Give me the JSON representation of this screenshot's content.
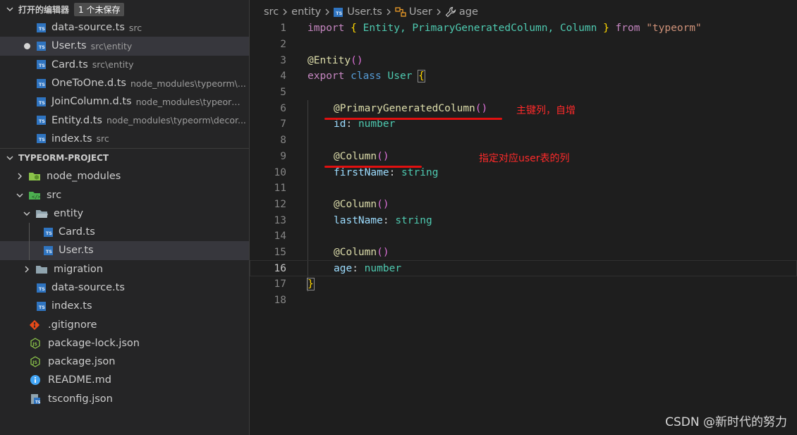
{
  "open_editors": {
    "title": "打开的编辑器",
    "badge": "1 个未保存",
    "items": [
      {
        "name": "data-source.ts",
        "desc": "src"
      },
      {
        "name": "User.ts",
        "desc": "src\\entity"
      },
      {
        "name": "Card.ts",
        "desc": "src\\entity"
      },
      {
        "name": "OneToOne.d.ts",
        "desc": "node_modules\\typeorm\\..."
      },
      {
        "name": "JoinColumn.d.ts",
        "desc": "node_modules\\typeorm..."
      },
      {
        "name": "Entity.d.ts",
        "desc": "node_modules\\typeorm\\decor..."
      },
      {
        "name": "index.ts",
        "desc": "src"
      }
    ]
  },
  "explorer": {
    "title": "TYPEORM-PROJECT",
    "items": [
      {
        "name": "node_modules"
      },
      {
        "name": "src"
      },
      {
        "name": "entity"
      },
      {
        "name": "Card.ts"
      },
      {
        "name": "User.ts"
      },
      {
        "name": "migration"
      },
      {
        "name": "data-source.ts"
      },
      {
        "name": "index.ts"
      },
      {
        "name": ".gitignore"
      },
      {
        "name": "package-lock.json"
      },
      {
        "name": "package.json"
      },
      {
        "name": "README.md"
      },
      {
        "name": "tsconfig.json"
      }
    ]
  },
  "breadcrumb": {
    "c1": "src",
    "c2": "entity",
    "c3": "User.ts",
    "c4": "User",
    "c5": "age"
  },
  "code": {
    "l1": {
      "num": "1",
      "t1": "import",
      "t2": " ",
      "t3": "{",
      "t4": " Entity, PrimaryGeneratedColumn, Column ",
      "t5": "}",
      "t6": " from ",
      "t7": "\"typeorm\""
    },
    "l2": {
      "num": "2"
    },
    "l3": {
      "num": "3",
      "t1": "@",
      "t2": "Entity",
      "t3": "()"
    },
    "l4": {
      "num": "4",
      "t1": "export",
      "t2": " class ",
      "t3": "User",
      "t4": " ",
      "t5": "{"
    },
    "l5": {
      "num": "5"
    },
    "l6": {
      "num": "6",
      "t1": "@",
      "t2": "PrimaryGeneratedColumn",
      "t3": "()"
    },
    "l7": {
      "num": "7",
      "t1": "id",
      "t2": ": ",
      "t3": "number"
    },
    "l8": {
      "num": "8"
    },
    "l9": {
      "num": "9",
      "t1": "@",
      "t2": "Column",
      "t3": "()"
    },
    "l10": {
      "num": "10",
      "t1": "firstName",
      "t2": ": ",
      "t3": "string"
    },
    "l11": {
      "num": "11"
    },
    "l12": {
      "num": "12",
      "t1": "@",
      "t2": "Column",
      "t3": "()"
    },
    "l13": {
      "num": "13",
      "t1": "lastName",
      "t2": ": ",
      "t3": "string"
    },
    "l14": {
      "num": "14"
    },
    "l15": {
      "num": "15",
      "t1": "@",
      "t2": "Column",
      "t3": "()"
    },
    "l16": {
      "num": "16",
      "t1": "age",
      "t2": ": ",
      "t3": "number"
    },
    "l17": {
      "num": "17",
      "t1": "}"
    },
    "l18": {
      "num": "18"
    }
  },
  "annotations": {
    "primary": "主键列，自增",
    "column": "指定对应user表的列"
  },
  "watermark": "CSDN @新时代的努力",
  "colors": {
    "keyword": "#c586c0",
    "storage": "#569cd6",
    "class": "#4ec9b0",
    "function": "#dcdcaa",
    "property": "#9cdcfe",
    "string": "#ce9178",
    "annotation": "#ff2a2a",
    "ts_icon": "#2f74c0"
  }
}
